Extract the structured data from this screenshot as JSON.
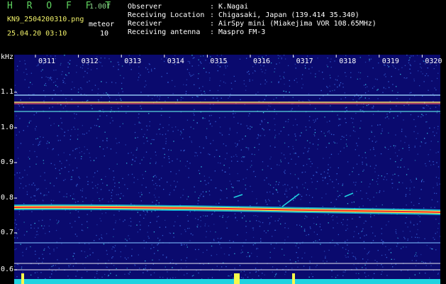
{
  "header": {
    "app_title": "H R O F F T",
    "version": "1.00f",
    "filename": "KN9_2504200310.png",
    "mode_label": "meteor",
    "timestamp": "25.04.20 03:10",
    "count": "10"
  },
  "info": {
    "labels": [
      "Observer",
      "Receiving Location",
      "Receiver",
      "Receiving antenna"
    ],
    "values": [
      ": K.Nagai",
      ": Chigasaki, Japan (139.414 35.340)",
      ": AirSpy mini (Miakejima VOR 108.65MHz)",
      ": Maspro FM-3"
    ]
  },
  "chart_data": {
    "type": "heatmap",
    "ylabel": "kHz",
    "y_ticks": [
      "1.1",
      "1.0",
      "0.9",
      "0.8",
      "0.7",
      "0.6"
    ],
    "x_ticks": [
      "0311",
      "0312",
      "0313",
      "0314",
      "0315",
      "0316",
      "0317",
      "0318",
      "0319",
      "0320"
    ]
  },
  "colors": {
    "background": "#0a0a6e",
    "signal_strong": "#ff2a2a",
    "signal_mid": "#f7f94a",
    "signal_low": "#1fd3e0"
  }
}
